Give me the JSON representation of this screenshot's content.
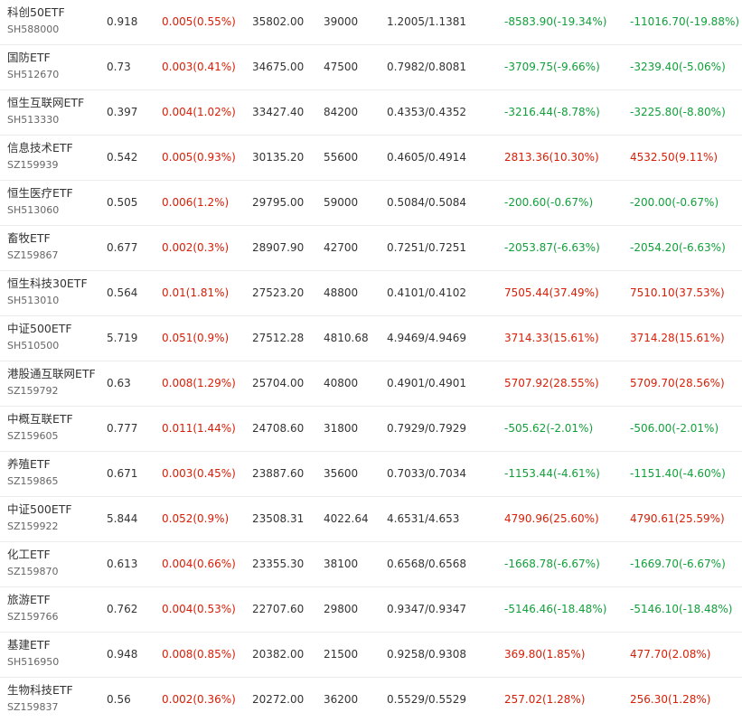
{
  "colors": {
    "up": "#d81e06",
    "down": "#11a03a",
    "text": "#333333",
    "subtext": "#666666",
    "divider": "#ececec"
  },
  "rows": [
    {
      "name": "科创50ETF",
      "code": "SH588000",
      "price": "0.918",
      "change": "0.005(0.55%)",
      "amount": "35802.00",
      "volume": "39000",
      "iopv": "1.2005/1.1381",
      "prem1": "-8583.90(-19.34%)",
      "prem1_dir": "neg",
      "prem2": "-11016.70(-19.88%)",
      "prem2_dir": "neg"
    },
    {
      "name": "国防ETF",
      "code": "SH512670",
      "price": "0.73",
      "change": "0.003(0.41%)",
      "amount": "34675.00",
      "volume": "47500",
      "iopv": "0.7982/0.8081",
      "prem1": "-3709.75(-9.66%)",
      "prem1_dir": "neg",
      "prem2": "-3239.40(-5.06%)",
      "prem2_dir": "neg"
    },
    {
      "name": "恒生互联网ETF",
      "code": "SH513330",
      "price": "0.397",
      "change": "0.004(1.02%)",
      "amount": "33427.40",
      "volume": "84200",
      "iopv": "0.4353/0.4352",
      "prem1": "-3216.44(-8.78%)",
      "prem1_dir": "neg",
      "prem2": "-3225.80(-8.80%)",
      "prem2_dir": "neg"
    },
    {
      "name": "信息技术ETF",
      "code": "SZ159939",
      "price": "0.542",
      "change": "0.005(0.93%)",
      "amount": "30135.20",
      "volume": "55600",
      "iopv": "0.4605/0.4914",
      "prem1": "2813.36(10.30%)",
      "prem1_dir": "pos",
      "prem2": "4532.50(9.11%)",
      "prem2_dir": "pos"
    },
    {
      "name": "恒生医疗ETF",
      "code": "SH513060",
      "price": "0.505",
      "change": "0.006(1.2%)",
      "amount": "29795.00",
      "volume": "59000",
      "iopv": "0.5084/0.5084",
      "prem1": "-200.60(-0.67%)",
      "prem1_dir": "neg",
      "prem2": "-200.00(-0.67%)",
      "prem2_dir": "neg"
    },
    {
      "name": "畜牧ETF",
      "code": "SZ159867",
      "price": "0.677",
      "change": "0.002(0.3%)",
      "amount": "28907.90",
      "volume": "42700",
      "iopv": "0.7251/0.7251",
      "prem1": "-2053.87(-6.63%)",
      "prem1_dir": "neg",
      "prem2": "-2054.20(-6.63%)",
      "prem2_dir": "neg"
    },
    {
      "name": "恒生科技30ETF",
      "code": "SH513010",
      "price": "0.564",
      "change": "0.01(1.81%)",
      "amount": "27523.20",
      "volume": "48800",
      "iopv": "0.4101/0.4102",
      "prem1": "7505.44(37.49%)",
      "prem1_dir": "pos",
      "prem2": "7510.10(37.53%)",
      "prem2_dir": "pos"
    },
    {
      "name": "中证500ETF",
      "code": "SH510500",
      "price": "5.719",
      "change": "0.051(0.9%)",
      "amount": "27512.28",
      "volume": "4810.68",
      "iopv": "4.9469/4.9469",
      "prem1": "3714.33(15.61%)",
      "prem1_dir": "pos",
      "prem2": "3714.28(15.61%)",
      "prem2_dir": "pos"
    },
    {
      "name": "港股通互联网ETF",
      "code": "SZ159792",
      "price": "0.63",
      "change": "0.008(1.29%)",
      "amount": "25704.00",
      "volume": "40800",
      "iopv": "0.4901/0.4901",
      "prem1": "5707.92(28.55%)",
      "prem1_dir": "pos",
      "prem2": "5709.70(28.56%)",
      "prem2_dir": "pos"
    },
    {
      "name": "中概互联ETF",
      "code": "SZ159605",
      "price": "0.777",
      "change": "0.011(1.44%)",
      "amount": "24708.60",
      "volume": "31800",
      "iopv": "0.7929/0.7929",
      "prem1": "-505.62(-2.01%)",
      "prem1_dir": "neg",
      "prem2": "-506.00(-2.01%)",
      "prem2_dir": "neg"
    },
    {
      "name": "养殖ETF",
      "code": "SZ159865",
      "price": "0.671",
      "change": "0.003(0.45%)",
      "amount": "23887.60",
      "volume": "35600",
      "iopv": "0.7033/0.7034",
      "prem1": "-1153.44(-4.61%)",
      "prem1_dir": "neg",
      "prem2": "-1151.40(-4.60%)",
      "prem2_dir": "neg"
    },
    {
      "name": "中证500ETF",
      "code": "SZ159922",
      "price": "5.844",
      "change": "0.052(0.9%)",
      "amount": "23508.31",
      "volume": "4022.64",
      "iopv": "4.6531/4.653",
      "prem1": "4790.96(25.60%)",
      "prem1_dir": "pos",
      "prem2": "4790.61(25.59%)",
      "prem2_dir": "pos"
    },
    {
      "name": "化工ETF",
      "code": "SZ159870",
      "price": "0.613",
      "change": "0.004(0.66%)",
      "amount": "23355.30",
      "volume": "38100",
      "iopv": "0.6568/0.6568",
      "prem1": "-1668.78(-6.67%)",
      "prem1_dir": "neg",
      "prem2": "-1669.70(-6.67%)",
      "prem2_dir": "neg"
    },
    {
      "name": "旅游ETF",
      "code": "SZ159766",
      "price": "0.762",
      "change": "0.004(0.53%)",
      "amount": "22707.60",
      "volume": "29800",
      "iopv": "0.9347/0.9347",
      "prem1": "-5146.46(-18.48%)",
      "prem1_dir": "neg",
      "prem2": "-5146.10(-18.48%)",
      "prem2_dir": "neg"
    },
    {
      "name": "基建ETF",
      "code": "SH516950",
      "price": "0.948",
      "change": "0.008(0.85%)",
      "amount": "20382.00",
      "volume": "21500",
      "iopv": "0.9258/0.9308",
      "prem1": "369.80(1.85%)",
      "prem1_dir": "pos",
      "prem2": "477.70(2.08%)",
      "prem2_dir": "pos"
    },
    {
      "name": "生物科技ETF",
      "code": "SZ159837",
      "price": "0.56",
      "change": "0.002(0.36%)",
      "amount": "20272.00",
      "volume": "36200",
      "iopv": "0.5529/0.5529",
      "prem1": "257.02(1.28%)",
      "prem1_dir": "pos",
      "prem2": "256.30(1.28%)",
      "prem2_dir": "pos"
    }
  ]
}
